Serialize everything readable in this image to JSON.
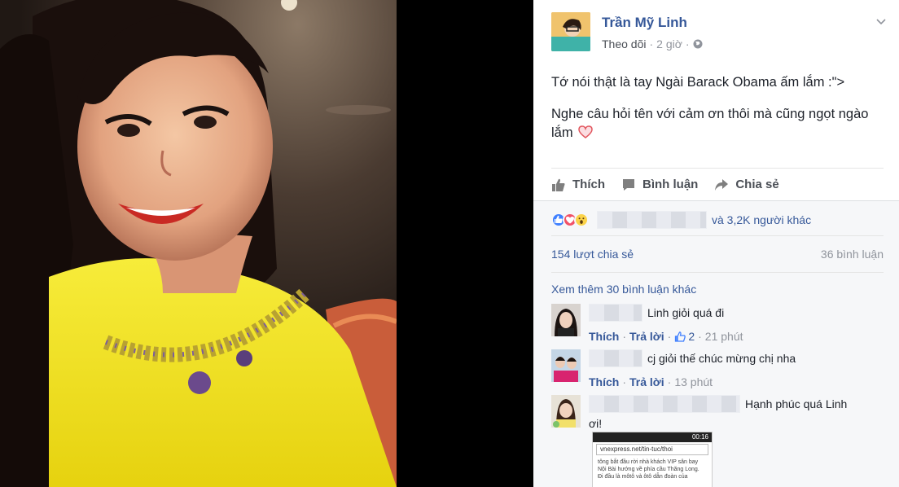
{
  "post": {
    "author": "Trần Mỹ Linh",
    "follow": "Theo dõi",
    "separator": "·",
    "time": "2 giờ",
    "text_line1": "Tớ nói thật là tay Ngài Barack Obama ấm lắm :\">",
    "text_line2": "Nghe câu hỏi tên với cảm ơn thôi mà cũng ngọt ngào lắm"
  },
  "actions": {
    "like": "Thích",
    "comment": "Bình luận",
    "share": "Chia sẻ"
  },
  "reactions": {
    "text": "và 3,2K người khác",
    "types": [
      "like-icon",
      "love-icon",
      "wow-icon"
    ]
  },
  "stats": {
    "shares": "154 lượt chia sẻ",
    "comments": "36 bình luận"
  },
  "comments": {
    "more": "Xem thêm 30 bình luận khác",
    "items": [
      {
        "text": "Linh giỏi quá đi",
        "like_label": "Thích",
        "reply_label": "Trả lời",
        "likes": "2",
        "time": "21 phút"
      },
      {
        "text": "cj giỏi thế chúc mừng chị nha",
        "like_label": "Thích",
        "reply_label": "Trả lời",
        "time": "13 phút"
      },
      {
        "text": "Hạnh phúc quá Linh",
        "text_cont": "ơi!"
      }
    ]
  },
  "attachment": {
    "status_time": "00:16",
    "url": "vnexpress.net/tin-tuc/thoi",
    "line1": "tông bắt đầu rời nhà khách VIP sân bay",
    "line2": "Nội Bài hướng về phía cầu Thăng Long.",
    "line3": "Đi đầu là môtô và ôtô dẫn đoàn của"
  },
  "colors": {
    "link": "#365899",
    "meta": "#90949c",
    "text": "#1d2129",
    "dress": "#f0e21e"
  }
}
